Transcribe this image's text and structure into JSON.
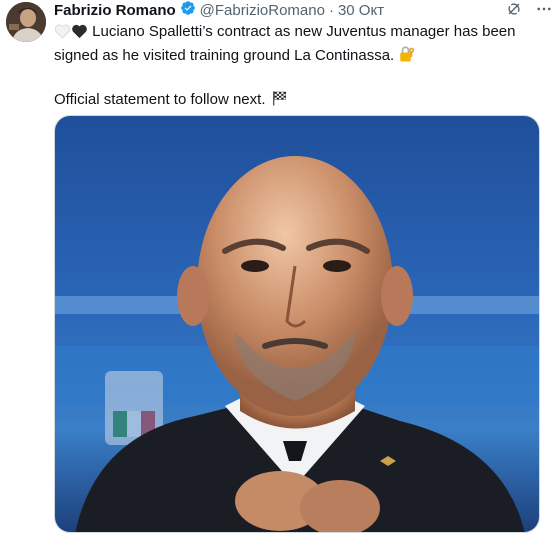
{
  "tweet": {
    "author_name": "Fabrizio Romano",
    "handle": "@FabrizioRomano",
    "separator": "·",
    "date": "30 Окт",
    "text_line1_rest": " Luciano Spalletti’s contract as new Juventus manager has been",
    "text_line2": "signed as he visited training ground La Continassa.",
    "text_line3": "Official statement to follow next.",
    "emojis": [
      "white-heart-icon",
      "black-heart-icon",
      "locked-key-icon",
      "chequered-flag-icon"
    ]
  },
  "icons": {
    "verified": "verified-badge-icon",
    "grok": "grok-icon",
    "more": "more-icon"
  },
  "colors": {
    "verified_blue": "#1d9bf0",
    "secondary_text": "#536471",
    "primary_text": "#0f1419"
  }
}
